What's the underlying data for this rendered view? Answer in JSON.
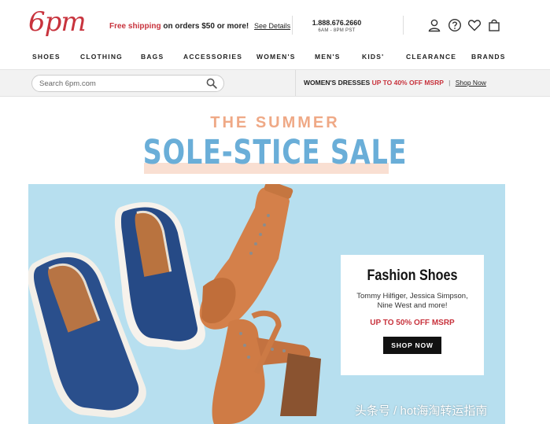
{
  "header": {
    "logo": "6pm",
    "shipping_red": "Free shipping",
    "shipping_black": " on orders $50 or more!",
    "shipping_link": "See Details",
    "phone": "1.888.676.2660",
    "hours": "6AM - 8PM PST",
    "icons": [
      "user-icon",
      "help-icon",
      "heart-icon",
      "bag-icon"
    ]
  },
  "nav": {
    "items": [
      "SHOES",
      "CLOTHING",
      "BAGS",
      "ACCESSORIES",
      "WOMEN'S",
      "MEN'S",
      "KIDS'",
      "CLEARANCE",
      "BRANDS"
    ]
  },
  "search": {
    "placeholder": "Search 6pm.com"
  },
  "promo": {
    "category": "WOMEN'S DRESSES",
    "offer": "UP TO 40% OFF MSRP",
    "separator": "|",
    "link": "Shop Now"
  },
  "hero": {
    "line1": "THE SUMMER",
    "line2": "SOLE-STICE SALE"
  },
  "banner": {
    "title": "Fashion Shoes",
    "brands": "Tommy Hilfiger, Jessica Simpson, Nine West and more!",
    "offer": "UP TO 50% OFF MSRP",
    "button": "SHOP NOW"
  },
  "watermark": "头条号 / hot海淘转运指南",
  "colors": {
    "brand_red": "#c8333d",
    "hero_peach": "#efa986",
    "hero_blue": "#6aaed8",
    "banner_bg": "#b7dfef"
  }
}
